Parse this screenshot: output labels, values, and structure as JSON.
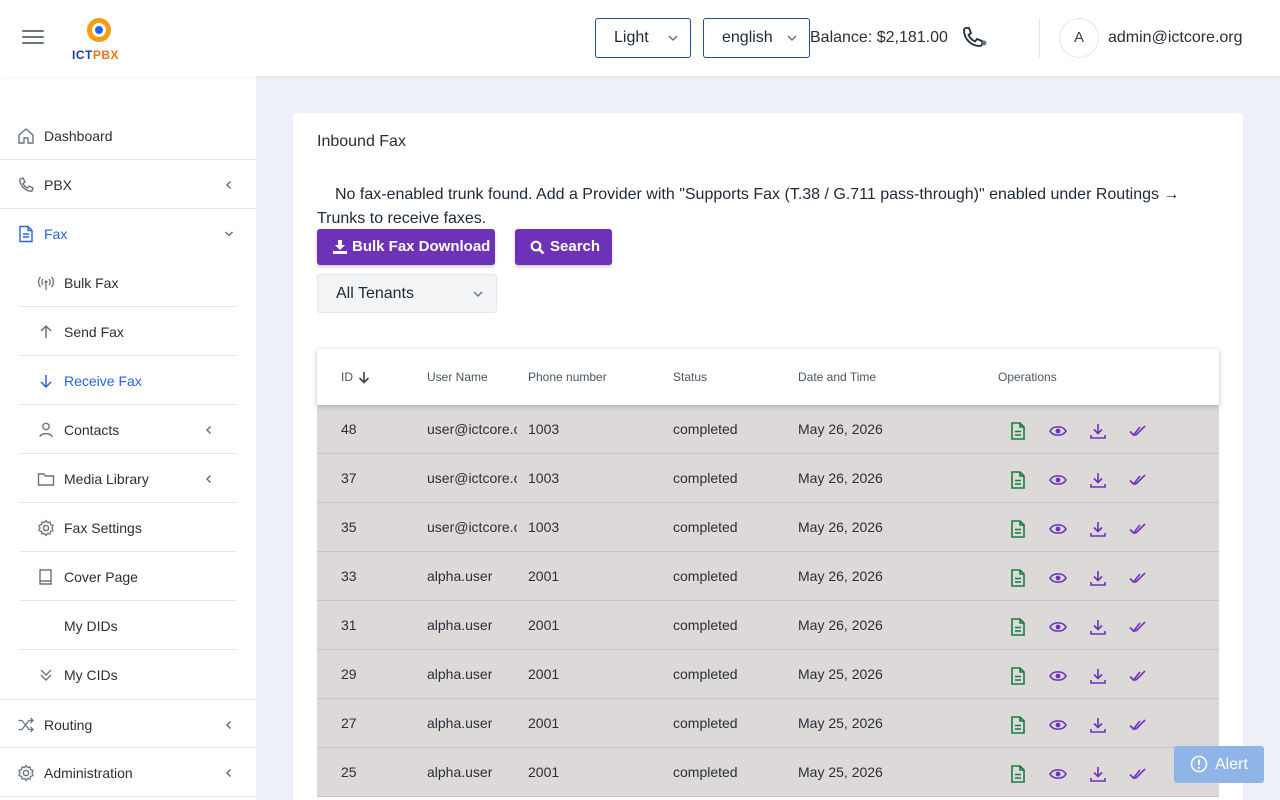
{
  "header": {
    "logo_text_1": "ICT",
    "logo_text_2": "PBX",
    "theme_select": "Light",
    "language_select": "english",
    "balance": "Balance: $2,181.00",
    "avatar_initial": "A",
    "user_email": "admin@ictcore.org"
  },
  "sidebar": {
    "dashboard": "Dashboard",
    "pbx": "PBX",
    "fax": "Fax",
    "fax_items": {
      "bulk_fax": "Bulk Fax",
      "send_fax": "Send Fax",
      "receive_fax": "Receive Fax",
      "contacts": "Contacts",
      "media_library": "Media Library",
      "fax_settings": "Fax Settings",
      "cover_page": "Cover Page",
      "my_dids": "My DIDs",
      "my_cids": "My CIDs"
    },
    "routing": "Routing",
    "administration": "Administration"
  },
  "main": {
    "title": "Inbound Fax",
    "notice": "No fax-enabled trunk found. Add a Provider with \"Supports Fax (T.38 / G.711 pass-through)\" enabled under Routings → Trunks to receive faxes.",
    "bulk_download_label": "Bulk Fax Download",
    "search_label": "Search",
    "tenant_select": "All Tenants"
  },
  "table": {
    "headers": {
      "id": "ID",
      "user_name": "User Name",
      "phone_number": "Phone number",
      "status": "Status",
      "date_time": "Date and Time",
      "operations": "Operations"
    },
    "rows": [
      {
        "id": "48",
        "user": "user@ictcore.org",
        "phone": "1003",
        "status": "completed",
        "date": "May 26, 2026"
      },
      {
        "id": "37",
        "user": "user@ictcore.org",
        "phone": "1003",
        "status": "completed",
        "date": "May 26, 2026"
      },
      {
        "id": "35",
        "user": "user@ictcore.org",
        "phone": "1003",
        "status": "completed",
        "date": "May 26, 2026"
      },
      {
        "id": "33",
        "user": "alpha.user",
        "phone": "2001",
        "status": "completed",
        "date": "May 26, 2026"
      },
      {
        "id": "31",
        "user": "alpha.user",
        "phone": "2001",
        "status": "completed",
        "date": "May 26, 2026"
      },
      {
        "id": "29",
        "user": "alpha.user",
        "phone": "2001",
        "status": "completed",
        "date": "May 25, 2026"
      },
      {
        "id": "27",
        "user": "alpha.user",
        "phone": "2001",
        "status": "completed",
        "date": "May 25, 2026"
      },
      {
        "id": "25",
        "user": "alpha.user",
        "phone": "2001",
        "status": "completed",
        "date": "May 25, 2026"
      }
    ]
  },
  "alert": {
    "label": "Alert"
  },
  "colors": {
    "primary_button": "#6d32b8",
    "active_nav": "#2563eb",
    "row_bg": "#dcd9d8",
    "pdf_icon": "#15803d",
    "action_icon": "#6d32b8",
    "alert_bg": "#8fb4e8"
  },
  "icons": [
    "menu-icon",
    "phone-icon",
    "home-icon",
    "phone-handset-icon",
    "document-icon",
    "broadcast-icon",
    "arrow-up-icon",
    "arrow-down-icon",
    "person-icon",
    "folder-icon",
    "gear-icon",
    "book-icon",
    "double-chevron-down-icon",
    "shuffle-icon",
    "settings-icon",
    "pdf-file-icon",
    "eye-icon",
    "download-icon",
    "double-check-icon",
    "alert-icon"
  ]
}
